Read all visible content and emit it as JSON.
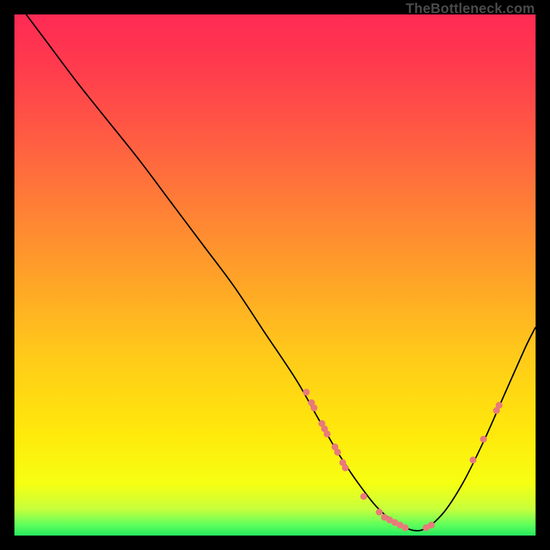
{
  "watermark": "TheBottleneck.com",
  "chart_data": {
    "type": "line",
    "title": "",
    "xlabel": "",
    "ylabel": "",
    "xlim": [
      0,
      100
    ],
    "ylim": [
      0,
      100
    ],
    "grid": false,
    "legend": false,
    "background_gradient": {
      "orientation": "vertical",
      "stops": [
        {
          "pct": 0,
          "color": "#ff2a54"
        },
        {
          "pct": 22,
          "color": "#ff5844"
        },
        {
          "pct": 50,
          "color": "#ffa128"
        },
        {
          "pct": 80,
          "color": "#ffe80b"
        },
        {
          "pct": 95,
          "color": "#c6ff3d"
        },
        {
          "pct": 100,
          "color": "#27e85f"
        }
      ]
    },
    "series": [
      {
        "name": "curve",
        "color": "#000000",
        "stroke_width": 2,
        "x": [
          0,
          6,
          12,
          18,
          24,
          30,
          36,
          42,
          48,
          54,
          58,
          62,
          66,
          70,
          74,
          78,
          82,
          86,
          90,
          94,
          98,
          100
        ],
        "y": [
          103,
          95,
          87,
          79.5,
          72,
          64,
          56,
          48,
          39,
          30,
          23,
          16,
          10,
          5,
          2,
          1,
          4,
          10,
          18,
          27,
          36,
          40
        ]
      }
    ],
    "markers": {
      "name": "highlight-points",
      "color": "#e87a7a",
      "radius": 5,
      "points": [
        {
          "x": 56.0,
          "y": 27.5
        },
        {
          "x": 57.0,
          "y": 25.5
        },
        {
          "x": 57.5,
          "y": 24.5
        },
        {
          "x": 59.0,
          "y": 21.5
        },
        {
          "x": 59.5,
          "y": 20.5
        },
        {
          "x": 60.0,
          "y": 19.5
        },
        {
          "x": 61.5,
          "y": 17.0
        },
        {
          "x": 62.0,
          "y": 16.0
        },
        {
          "x": 63.0,
          "y": 14.0
        },
        {
          "x": 63.5,
          "y": 13.0
        },
        {
          "x": 67.0,
          "y": 7.5
        },
        {
          "x": 70.0,
          "y": 4.5
        },
        {
          "x": 71.0,
          "y": 3.5
        },
        {
          "x": 72.0,
          "y": 3.0
        },
        {
          "x": 73.0,
          "y": 2.5
        },
        {
          "x": 74.0,
          "y": 2.0
        },
        {
          "x": 75.0,
          "y": 1.5
        },
        {
          "x": 79.0,
          "y": 1.5
        },
        {
          "x": 80.0,
          "y": 2.0
        },
        {
          "x": 88.0,
          "y": 14.5
        },
        {
          "x": 90.0,
          "y": 18.5
        },
        {
          "x": 92.5,
          "y": 24.0
        },
        {
          "x": 93.0,
          "y": 25.0
        }
      ]
    }
  }
}
